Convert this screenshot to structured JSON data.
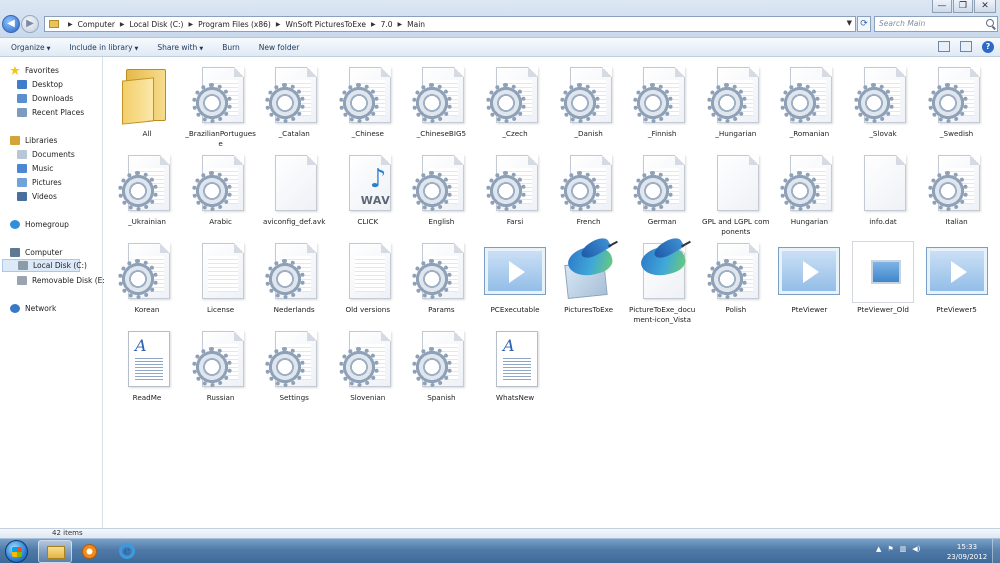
{
  "window": {
    "minimize": "—",
    "maximize": "❐",
    "close": "✕"
  },
  "address": {
    "crumbs": [
      "Computer",
      "Local Disk (C:)",
      "Program Files (x86)",
      "WnSoft PicturesToExe",
      "7.0",
      "Main"
    ]
  },
  "search": {
    "placeholder": "Search Main"
  },
  "toolbar": {
    "organize": "Organize",
    "include_in_library": "Include in library",
    "share_with": "Share with",
    "burn": "Burn",
    "new_folder": "New folder"
  },
  "nav": {
    "favorites": "Favorites",
    "desktop": "Desktop",
    "downloads": "Downloads",
    "recent_places": "Recent Places",
    "libraries": "Libraries",
    "documents": "Documents",
    "music": "Music",
    "pictures": "Pictures",
    "videos": "Videos",
    "homegroup": "Homegroup",
    "computer": "Computer",
    "local_disk": "Local Disk (C:)",
    "removable_disk": "Removable Disk (E:)",
    "network": "Network"
  },
  "files": [
    {
      "name": "All",
      "icon": "folder-icon"
    },
    {
      "name": "_BrazilianPortuguese",
      "icon": "config-file-icon"
    },
    {
      "name": "_Catalan",
      "icon": "config-file-icon"
    },
    {
      "name": "_Chinese",
      "icon": "config-file-icon"
    },
    {
      "name": "_ChineseBIG5",
      "icon": "config-file-icon"
    },
    {
      "name": "_Czech",
      "icon": "config-file-icon"
    },
    {
      "name": "_Danish",
      "icon": "config-file-icon"
    },
    {
      "name": "_Finnish",
      "icon": "config-file-icon"
    },
    {
      "name": "_Hungarian",
      "icon": "config-file-icon"
    },
    {
      "name": "_Romanian",
      "icon": "config-file-icon"
    },
    {
      "name": "_Slovak",
      "icon": "config-file-icon"
    },
    {
      "name": "_Swedish",
      "icon": "config-file-icon"
    },
    {
      "name": "_Ukrainian",
      "icon": "config-file-icon"
    },
    {
      "name": "Arabic",
      "icon": "config-file-icon"
    },
    {
      "name": "aviconfig_def.avk",
      "icon": "blank-file-icon"
    },
    {
      "name": "CLICK",
      "icon": "wav-file-icon"
    },
    {
      "name": "English",
      "icon": "config-file-icon"
    },
    {
      "name": "Farsi",
      "icon": "config-file-icon"
    },
    {
      "name": "French",
      "icon": "config-file-icon"
    },
    {
      "name": "German",
      "icon": "config-file-icon"
    },
    {
      "name": "GPL and LGPL components",
      "icon": "blank-file-icon"
    },
    {
      "name": "Hungarian",
      "icon": "config-file-icon"
    },
    {
      "name": "info.dat",
      "icon": "blank-file-icon"
    },
    {
      "name": "Italian",
      "icon": "config-file-icon"
    },
    {
      "name": "Korean",
      "icon": "config-file-icon"
    },
    {
      "name": "License",
      "icon": "text-file-icon"
    },
    {
      "name": "Nederlands",
      "icon": "config-file-icon"
    },
    {
      "name": "Old versions",
      "icon": "text-file-icon"
    },
    {
      "name": "Params",
      "icon": "config-file-icon"
    },
    {
      "name": "PCExecutable",
      "icon": "video-file-icon"
    },
    {
      "name": "PicturesToExe",
      "icon": "hummingbird-app-icon"
    },
    {
      "name": "PictureToExe_document-icon_Vista",
      "icon": "hummingbird-document-icon"
    },
    {
      "name": "Polish",
      "icon": "config-file-icon"
    },
    {
      "name": "PteViewer",
      "icon": "video-file-icon"
    },
    {
      "name": "PteViewer_Old",
      "icon": "image-thumbnail-icon"
    },
    {
      "name": "PteViewer5",
      "icon": "video-file-icon"
    },
    {
      "name": "ReadMe",
      "icon": "rtf-document-icon"
    },
    {
      "name": "Russian",
      "icon": "config-file-icon"
    },
    {
      "name": "Settings",
      "icon": "config-file-icon"
    },
    {
      "name": "Slovenian",
      "icon": "config-file-icon"
    },
    {
      "name": "Spanish",
      "icon": "config-file-icon"
    },
    {
      "name": "WhatsNew",
      "icon": "rtf-document-icon"
    }
  ],
  "status": {
    "item_count": "42 items"
  },
  "taskbar": {
    "time": "15:33",
    "date": "23/09/2012"
  }
}
